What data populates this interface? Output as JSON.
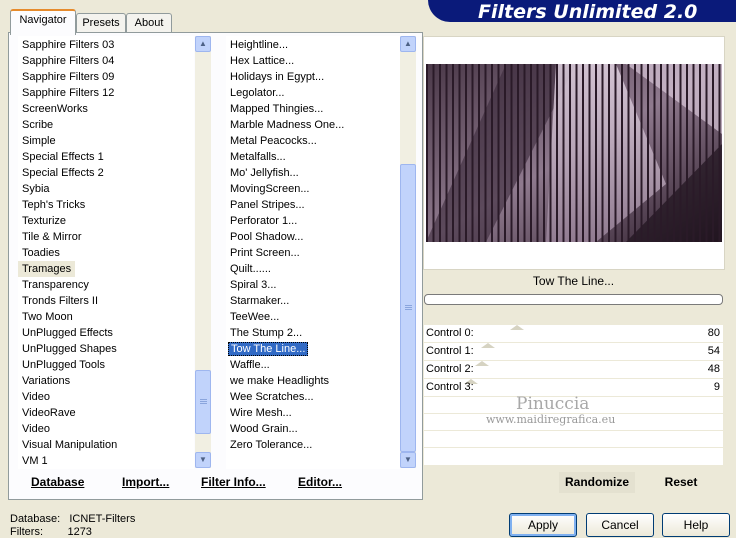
{
  "tabs": [
    {
      "label": "Navigator"
    },
    {
      "label": "Presets"
    },
    {
      "label": "About"
    }
  ],
  "banner": {
    "title": "Filters Unlimited 2.0"
  },
  "categories": {
    "items": [
      "Sapphire Filters 03",
      "Sapphire Filters 04",
      "Sapphire Filters 09",
      "Sapphire Filters 12",
      "ScreenWorks",
      "Scribe",
      "Simple",
      "Special Effects 1",
      "Special Effects 2",
      "Sybia",
      "Teph's Tricks",
      "Texturize",
      "Tile & Mirror",
      "Toadies",
      "Tramages",
      "Transparency",
      "Tronds Filters II",
      "Two Moon",
      "UnPlugged Effects",
      "UnPlugged Shapes",
      "UnPlugged Tools",
      "Variations",
      "Video",
      "VideoRave",
      "Video",
      "Visual Manipulation",
      "VM 1"
    ],
    "highlighted": "Tramages"
  },
  "filters": {
    "items": [
      "Heightline...",
      "Hex Lattice...",
      "Holidays in Egypt...",
      "Legolator...",
      "Mapped Thingies...",
      "Marble Madness One...",
      "Metal Peacocks...",
      "Metalfalls...",
      "Mo' Jellyfish...",
      "MovingScreen...",
      "Panel Stripes...",
      "Perforator 1...",
      "Pool Shadow...",
      "Print Screen...",
      "Quilt......",
      "Spiral 3...",
      "Starmaker...",
      "TeeWee...",
      "The Stump 2...",
      "Tow The Line...",
      "Waffle...",
      "we make Headlights",
      "Wee Scratches...",
      "Wire Mesh...",
      "Wood Grain...",
      "Zero Tolerance..."
    ],
    "selected": "Tow The Line..."
  },
  "toolbar": {
    "database": "Database",
    "import": "Import...",
    "filter_info": "Filter Info...",
    "editor": "Editor..."
  },
  "preview": {
    "filter_name": "Tow The Line...",
    "progress": 0,
    "colors": {
      "dark": "#2a1a28",
      "mid": "#7a6478",
      "light": "#d8c8d8"
    }
  },
  "controls": [
    {
      "label": "Control 0:",
      "value": "80"
    },
    {
      "label": "Control 1:",
      "value": "54"
    },
    {
      "label": "Control 2:",
      "value": "48"
    },
    {
      "label": "Control 3:",
      "value": "9"
    }
  ],
  "watermark": {
    "name": "Pinuccia",
    "url": "www.maidiregrafica.eu"
  },
  "actions": {
    "randomize": "Randomize",
    "reset": "Reset"
  },
  "status": {
    "database_label": "Database:",
    "database_value": "ICNET-Filters",
    "filters_label": "Filters:",
    "filters_value": "1273"
  },
  "dialog_buttons": {
    "apply": "Apply",
    "cancel": "Cancel",
    "help": "Help"
  }
}
